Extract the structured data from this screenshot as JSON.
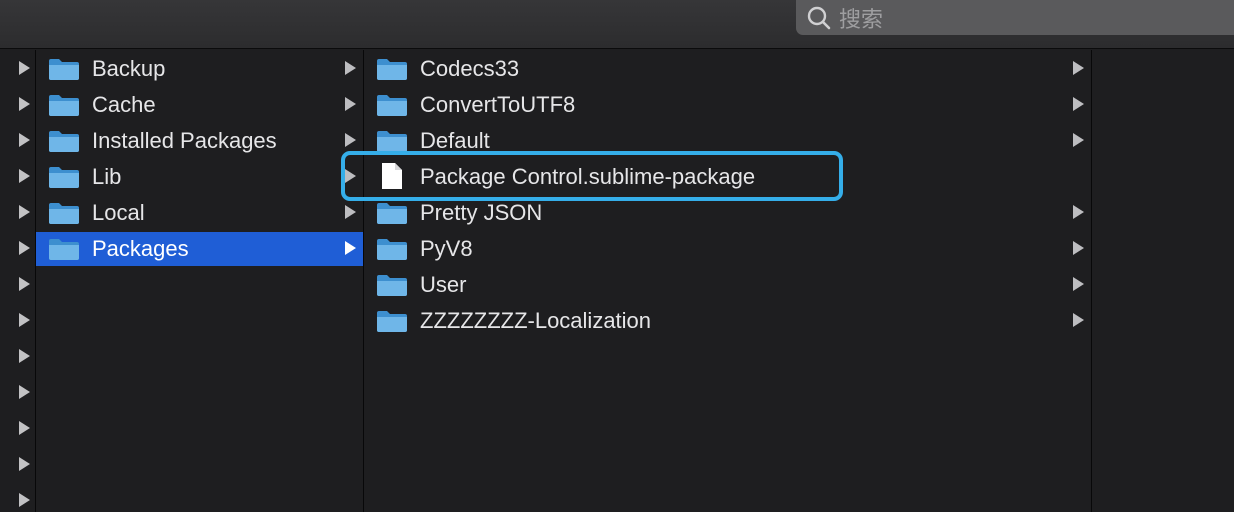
{
  "search": {
    "placeholder": "搜索"
  },
  "column0": {
    "rows": 13
  },
  "column1": {
    "items": [
      {
        "label": "Backup",
        "type": "folder"
      },
      {
        "label": "Cache",
        "type": "folder"
      },
      {
        "label": "Installed Packages",
        "type": "folder"
      },
      {
        "label": "Lib",
        "type": "folder"
      },
      {
        "label": "Local",
        "type": "folder"
      },
      {
        "label": "Packages",
        "type": "folder",
        "selected": true
      }
    ]
  },
  "column2": {
    "items": [
      {
        "label": "Codecs33",
        "type": "folder"
      },
      {
        "label": "ConvertToUTF8",
        "type": "folder"
      },
      {
        "label": "Default",
        "type": "folder"
      },
      {
        "label": "Package Control.sublime-package",
        "type": "file",
        "highlighted": true
      },
      {
        "label": "Pretty JSON",
        "type": "folder"
      },
      {
        "label": "PyV8",
        "type": "folder"
      },
      {
        "label": "User",
        "type": "folder"
      },
      {
        "label": "ZZZZZZZZ-Localization",
        "type": "folder"
      }
    ]
  },
  "colors": {
    "selection": "#1f5ed6",
    "highlight_border": "#35aee9",
    "folder": "#6fb6e8",
    "background": "#1e1e20"
  }
}
